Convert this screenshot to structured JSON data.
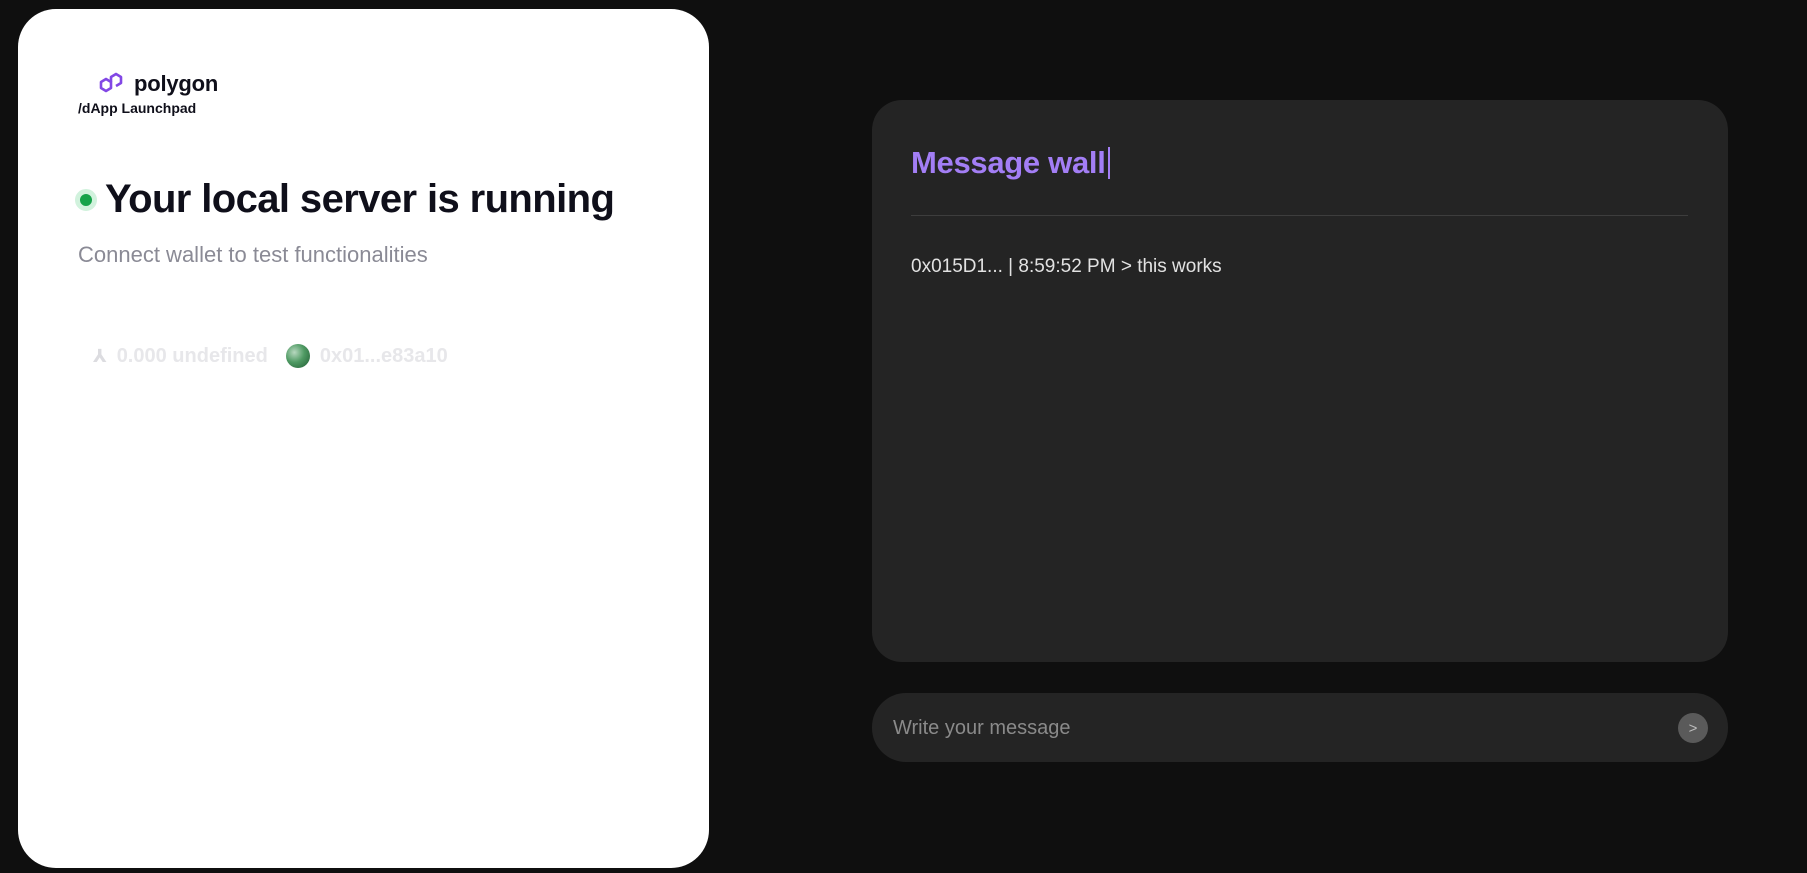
{
  "brand": {
    "name": "polygon",
    "subtitle": "/dApp Launchpad",
    "logo_icon": "polygon-logo-icon",
    "accent": "#8247e5"
  },
  "status": {
    "title": "Your local server is running",
    "subtitle": "Connect wallet to test functionalities",
    "indicator_color": "#16a34a"
  },
  "wallet": {
    "network_icon": "ethereum-icon",
    "balance": "0.000 undefined",
    "avatar_icon": "wallet-avatar",
    "address": "0x01...e83a10"
  },
  "message_wall": {
    "title": "Message wall",
    "title_color": "#a37ef5",
    "messages": [
      {
        "text": "0x015D1... | 8:59:52 PM > this works"
      }
    ]
  },
  "composer": {
    "placeholder": "Write your message",
    "value": "",
    "send_label": ">"
  }
}
